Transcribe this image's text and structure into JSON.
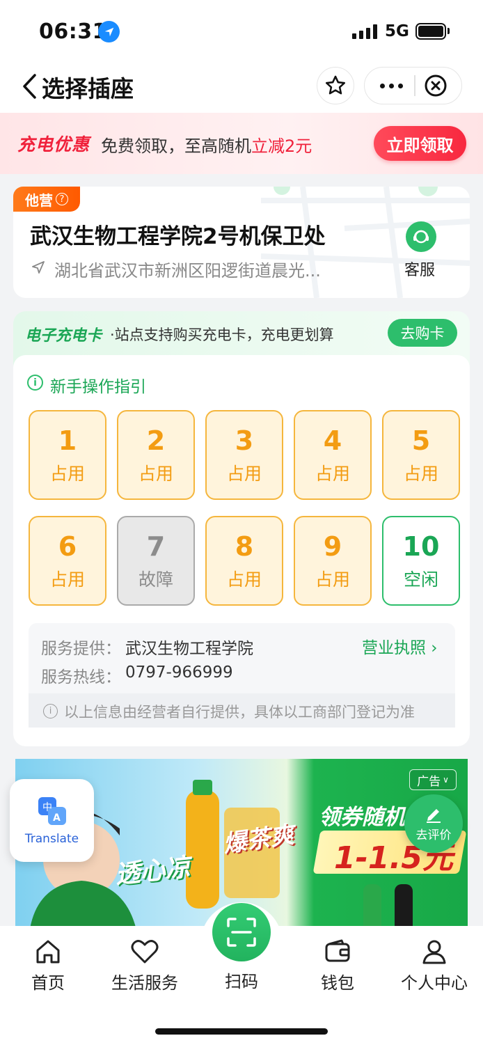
{
  "status_bar": {
    "time": "06:31",
    "network": "5G"
  },
  "nav": {
    "title": "选择插座"
  },
  "promo": {
    "brand": "充电优惠",
    "text_prefix": "免费领取，至高随机",
    "text_highlight": "立减2元",
    "button": "立即领取",
    "accent_color": "#f0213b"
  },
  "station": {
    "operator_badge": "他营",
    "name": "武汉生物工程学院2号机保卫处",
    "address": "湖北省武汉市新洲区阳逻街道晨光...",
    "service_label": "客服"
  },
  "ecard": {
    "brand": "电子充电卡",
    "text": "·站点支持购买充电卡，充电更划算",
    "button": "去购卡"
  },
  "guide": {
    "label": "新手操作指引"
  },
  "sockets": [
    {
      "num": "1",
      "status": "占用",
      "state": "busy"
    },
    {
      "num": "2",
      "status": "占用",
      "state": "busy"
    },
    {
      "num": "3",
      "status": "占用",
      "state": "busy"
    },
    {
      "num": "4",
      "status": "占用",
      "state": "busy"
    },
    {
      "num": "5",
      "status": "占用",
      "state": "busy"
    },
    {
      "num": "6",
      "status": "占用",
      "state": "busy"
    },
    {
      "num": "7",
      "status": "故障",
      "state": "fault"
    },
    {
      "num": "8",
      "status": "占用",
      "state": "busy"
    },
    {
      "num": "9",
      "status": "占用",
      "state": "busy"
    },
    {
      "num": "10",
      "status": "空闲",
      "state": "idle"
    }
  ],
  "provider": {
    "label": "服务提供：",
    "value": "武汉生物工程学院",
    "license_link": "营业执照",
    "hotline_label": "服务热线：",
    "hotline_value": "0797-966999",
    "note": "以上信息由经营者自行提供，具体以工商部门登记为准"
  },
  "ad": {
    "tag": "广告",
    "title": "领券随机",
    "price": "1-1.5元",
    "slogan": "透心凉",
    "slogan2": "爆茶爽"
  },
  "floating": {
    "translate_label": "Translate",
    "review_label": "去评价"
  },
  "tabbar": {
    "items": [
      {
        "label": "首页",
        "icon": "home-icon"
      },
      {
        "label": "生活服务",
        "icon": "heart-icon"
      },
      {
        "label": "扫码",
        "icon": "scan-icon"
      },
      {
        "label": "钱包",
        "icon": "wallet-icon"
      },
      {
        "label": "个人中心",
        "icon": "user-icon"
      }
    ]
  },
  "colors": {
    "green": "#2dbe6c",
    "orange": "#f39c12",
    "red": "#f0213b"
  }
}
